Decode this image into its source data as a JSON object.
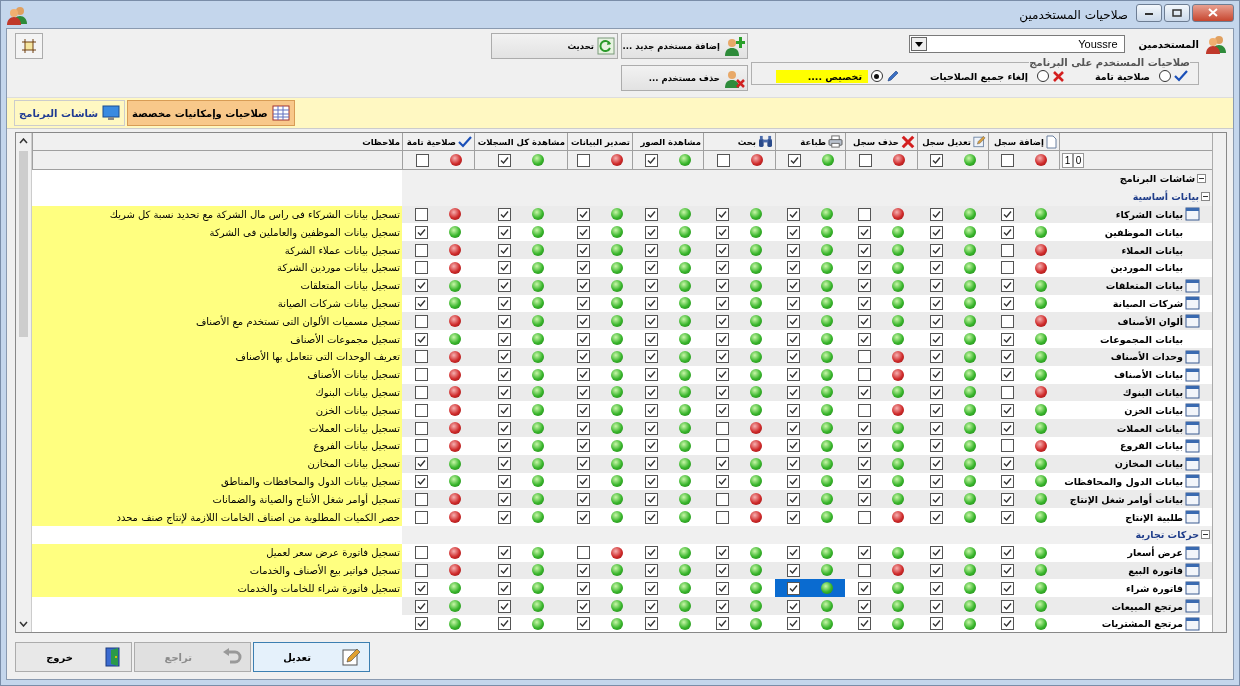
{
  "window": {
    "title": "صلاحيات المستخدمين"
  },
  "toolbar": {
    "users_label": "المستخدمين",
    "user": "Youssre",
    "add_user": "إضافة مستخدم جديد ...",
    "refresh": "تحديث",
    "delete_user": "حذف مستخدم ...",
    "permission_mode": {
      "legend": "صلاحيات المستخدم على البرنامج",
      "options": [
        {
          "label": "صلاحية تامة",
          "selected": false
        },
        {
          "label": "إلغاء جميع الصلاحيات",
          "selected": false
        },
        {
          "label": "تخصيص ....",
          "selected": true
        }
      ]
    }
  },
  "tabs": [
    {
      "label": "صلاحيات وإمكانيات مخصصة",
      "selected": true
    },
    {
      "label": "شاشات البرنامج",
      "selected": false
    }
  ],
  "grid": {
    "columns": [
      {
        "label": "إضافة سجل"
      },
      {
        "label": "تعديل سجل"
      },
      {
        "label": "حذف سجل"
      },
      {
        "label": "طباعة"
      },
      {
        "label": "بحث"
      },
      {
        "label": "مشاهدة الصور"
      },
      {
        "label": "تصدير البيانات"
      },
      {
        "label": "مشاهدة كل السجلات"
      },
      {
        "label": "صلاحية تامة"
      }
    ],
    "notes_label": "ملاحظات",
    "header_counters": [
      "0",
      "1"
    ],
    "header_checks": [
      {
        "checked": false
      },
      {
        "checked": true
      },
      {
        "checked": false
      },
      {
        "checked": true
      },
      {
        "checked": false
      },
      {
        "checked": true
      },
      {
        "checked": false
      },
      {
        "checked": true
      },
      {
        "checked": false
      }
    ],
    "tree": {
      "label": "شاشات البرنامج",
      "expanded": true,
      "children": [
        {
          "label": "بيانات أساسية",
          "expanded": true,
          "children": [
            {
              "label": "بيانات الشركاء",
              "has_icon": true,
              "note": "تسجيل بيانات الشركاء فى راس مال الشركة مع تحديد نسبة كل شريك",
              "perms": [
                {
                  "checked": true,
                  "selected": false
                },
                {
                  "checked": true,
                  "selected": false
                },
                {
                  "checked": false,
                  "selected": false
                },
                {
                  "checked": true,
                  "selected": false
                },
                {
                  "checked": true,
                  "selected": false
                },
                {
                  "checked": true,
                  "selected": false
                },
                {
                  "checked": true,
                  "selected": false
                },
                {
                  "checked": true,
                  "selected": false
                },
                {
                  "checked": false,
                  "selected": false
                }
              ]
            },
            {
              "label": "بيانات الموظفين",
              "has_icon": false,
              "note": "تسجيل بيانات الموظفين والعاملين فى الشركة",
              "perms": [
                {
                  "checked": true,
                  "selected": false
                },
                {
                  "checked": true,
                  "selected": false
                },
                {
                  "checked": true,
                  "selected": false
                },
                {
                  "checked": true,
                  "selected": false
                },
                {
                  "checked": true,
                  "selected": false
                },
                {
                  "checked": true,
                  "selected": false
                },
                {
                  "checked": true,
                  "selected": false
                },
                {
                  "checked": true,
                  "selected": false
                },
                {
                  "checked": true,
                  "selected": false
                }
              ]
            },
            {
              "label": "بيانات العملاء",
              "has_icon": false,
              "note": "تسجيل بيانات عملاء الشركة",
              "perms": [
                {
                  "checked": false,
                  "selected": false
                },
                {
                  "checked": true,
                  "selected": false
                },
                {
                  "checked": true,
                  "selected": false
                },
                {
                  "checked": true,
                  "selected": false
                },
                {
                  "checked": true,
                  "selected": false
                },
                {
                  "checked": true,
                  "selected": false
                },
                {
                  "checked": true,
                  "selected": false
                },
                {
                  "checked": true,
                  "selected": false
                },
                {
                  "checked": false,
                  "selected": false
                }
              ]
            },
            {
              "label": "بيانات الموردين",
              "has_icon": false,
              "note": "تسجيل بيانات موردين الشركة",
              "perms": [
                {
                  "checked": false,
                  "selected": false
                },
                {
                  "checked": true,
                  "selected": false
                },
                {
                  "checked": true,
                  "selected": false
                },
                {
                  "checked": true,
                  "selected": false
                },
                {
                  "checked": true,
                  "selected": false
                },
                {
                  "checked": true,
                  "selected": false
                },
                {
                  "checked": true,
                  "selected": false
                },
                {
                  "checked": true,
                  "selected": false
                },
                {
                  "checked": false,
                  "selected": false
                }
              ]
            },
            {
              "label": "بيانات  المتعلقات",
              "has_icon": true,
              "note": "تسجيل بيانات المتعلقات",
              "perms": [
                {
                  "checked": true,
                  "selected": false
                },
                {
                  "checked": true,
                  "selected": false
                },
                {
                  "checked": true,
                  "selected": false
                },
                {
                  "checked": true,
                  "selected": false
                },
                {
                  "checked": true,
                  "selected": false
                },
                {
                  "checked": true,
                  "selected": false
                },
                {
                  "checked": true,
                  "selected": false
                },
                {
                  "checked": true,
                  "selected": false
                },
                {
                  "checked": true,
                  "selected": false
                }
              ]
            },
            {
              "label": "شركات الصيانة",
              "has_icon": true,
              "note": "تسجيل بيانات شركات الصيانة",
              "perms": [
                {
                  "checked": true,
                  "selected": false
                },
                {
                  "checked": true,
                  "selected": false
                },
                {
                  "checked": true,
                  "selected": false
                },
                {
                  "checked": true,
                  "selected": false
                },
                {
                  "checked": true,
                  "selected": false
                },
                {
                  "checked": true,
                  "selected": false
                },
                {
                  "checked": true,
                  "selected": false
                },
                {
                  "checked": true,
                  "selected": false
                },
                {
                  "checked": true,
                  "selected": false
                }
              ]
            },
            {
              "label": "ألوان الأصناف",
              "has_icon": true,
              "note": "تسجيل مسميات الألوان التى تستخدم مع الأصناف",
              "perms": [
                {
                  "checked": false,
                  "selected": false
                },
                {
                  "checked": true,
                  "selected": false
                },
                {
                  "checked": true,
                  "selected": false
                },
                {
                  "checked": true,
                  "selected": false
                },
                {
                  "checked": true,
                  "selected": false
                },
                {
                  "checked": true,
                  "selected": false
                },
                {
                  "checked": true,
                  "selected": false
                },
                {
                  "checked": true,
                  "selected": false
                },
                {
                  "checked": false,
                  "selected": false
                }
              ]
            },
            {
              "label": "بيانات المجموعات",
              "has_icon": false,
              "note": "تسجيل  مجموعات الأصناف",
              "perms": [
                {
                  "checked": true,
                  "selected": false
                },
                {
                  "checked": true,
                  "selected": false
                },
                {
                  "checked": true,
                  "selected": false
                },
                {
                  "checked": true,
                  "selected": false
                },
                {
                  "checked": true,
                  "selected": false
                },
                {
                  "checked": true,
                  "selected": false
                },
                {
                  "checked": true,
                  "selected": false
                },
                {
                  "checked": true,
                  "selected": false
                },
                {
                  "checked": true,
                  "selected": false
                }
              ]
            },
            {
              "label": "وحدات الأصناف",
              "has_icon": true,
              "note": "تعريف الوحدات التى تتعامل بها الأصناف",
              "perms": [
                {
                  "checked": true,
                  "selected": false
                },
                {
                  "checked": true,
                  "selected": false
                },
                {
                  "checked": false,
                  "selected": false
                },
                {
                  "checked": true,
                  "selected": false
                },
                {
                  "checked": true,
                  "selected": false
                },
                {
                  "checked": true,
                  "selected": false
                },
                {
                  "checked": true,
                  "selected": false
                },
                {
                  "checked": true,
                  "selected": false
                },
                {
                  "checked": false,
                  "selected": false
                }
              ]
            },
            {
              "label": "بيانات الأصناف",
              "has_icon": true,
              "note": "تسجيل  بيانات الأصناف",
              "perms": [
                {
                  "checked": true,
                  "selected": false
                },
                {
                  "checked": true,
                  "selected": false
                },
                {
                  "checked": false,
                  "selected": false
                },
                {
                  "checked": true,
                  "selected": false
                },
                {
                  "checked": true,
                  "selected": false
                },
                {
                  "checked": true,
                  "selected": false
                },
                {
                  "checked": true,
                  "selected": false
                },
                {
                  "checked": true,
                  "selected": false
                },
                {
                  "checked": false,
                  "selected": false
                }
              ]
            },
            {
              "label": "بيانات البنوك",
              "has_icon": true,
              "note": "تسجيل  بيانات البنوك",
              "perms": [
                {
                  "checked": false,
                  "selected": false
                },
                {
                  "checked": true,
                  "selected": false
                },
                {
                  "checked": true,
                  "selected": false
                },
                {
                  "checked": true,
                  "selected": false
                },
                {
                  "checked": true,
                  "selected": false
                },
                {
                  "checked": true,
                  "selected": false
                },
                {
                  "checked": true,
                  "selected": false
                },
                {
                  "checked": true,
                  "selected": false
                },
                {
                  "checked": false,
                  "selected": false
                }
              ]
            },
            {
              "label": "بيانات الخزن",
              "has_icon": true,
              "note": "تسجيل  بيانات الخزن",
              "perms": [
                {
                  "checked": true,
                  "selected": false
                },
                {
                  "checked": true,
                  "selected": false
                },
                {
                  "checked": false,
                  "selected": false
                },
                {
                  "checked": true,
                  "selected": false
                },
                {
                  "checked": true,
                  "selected": false
                },
                {
                  "checked": true,
                  "selected": false
                },
                {
                  "checked": true,
                  "selected": false
                },
                {
                  "checked": true,
                  "selected": false
                },
                {
                  "checked": false,
                  "selected": false
                }
              ]
            },
            {
              "label": "بيانات العملات",
              "has_icon": true,
              "note": "تسجيل  بيانات العملات",
              "perms": [
                {
                  "checked": true,
                  "selected": false
                },
                {
                  "checked": true,
                  "selected": false
                },
                {
                  "checked": true,
                  "selected": false
                },
                {
                  "checked": true,
                  "selected": false
                },
                {
                  "checked": false,
                  "selected": false
                },
                {
                  "checked": true,
                  "selected": false
                },
                {
                  "checked": true,
                  "selected": false
                },
                {
                  "checked": true,
                  "selected": false
                },
                {
                  "checked": false,
                  "selected": false
                }
              ]
            },
            {
              "label": "بيانات الفروع",
              "has_icon": true,
              "note": "تسجيل  بيانات الفروع",
              "perms": [
                {
                  "checked": false,
                  "selected": false
                },
                {
                  "checked": true,
                  "selected": false
                },
                {
                  "checked": true,
                  "selected": false
                },
                {
                  "checked": true,
                  "selected": false
                },
                {
                  "checked": false,
                  "selected": false
                },
                {
                  "checked": true,
                  "selected": false
                },
                {
                  "checked": true,
                  "selected": false
                },
                {
                  "checked": true,
                  "selected": false
                },
                {
                  "checked": false,
                  "selected": false
                }
              ]
            },
            {
              "label": "بيانات المخازن",
              "has_icon": true,
              "note": "تسجيل  بيانات المخازن",
              "perms": [
                {
                  "checked": true,
                  "selected": false
                },
                {
                  "checked": true,
                  "selected": false
                },
                {
                  "checked": true,
                  "selected": false
                },
                {
                  "checked": true,
                  "selected": false
                },
                {
                  "checked": true,
                  "selected": false
                },
                {
                  "checked": true,
                  "selected": false
                },
                {
                  "checked": true,
                  "selected": false
                },
                {
                  "checked": true,
                  "selected": false
                },
                {
                  "checked": true,
                  "selected": false
                }
              ]
            },
            {
              "label": "بيانات الدول والمحافظات",
              "has_icon": true,
              "note": "تسجيل  بيانات الدول والمحافظات والمناطق",
              "perms": [
                {
                  "checked": true,
                  "selected": false
                },
                {
                  "checked": true,
                  "selected": false
                },
                {
                  "checked": true,
                  "selected": false
                },
                {
                  "checked": true,
                  "selected": false
                },
                {
                  "checked": true,
                  "selected": false
                },
                {
                  "checked": true,
                  "selected": false
                },
                {
                  "checked": true,
                  "selected": false
                },
                {
                  "checked": true,
                  "selected": false
                },
                {
                  "checked": true,
                  "selected": false
                }
              ]
            },
            {
              "label": "بيانات أوامر شغل الإنتاج",
              "has_icon": true,
              "note": "تسجيل أوامر شغل الأنتاج والصيانة والضمانات",
              "perms": [
                {
                  "checked": true,
                  "selected": false
                },
                {
                  "checked": true,
                  "selected": false
                },
                {
                  "checked": true,
                  "selected": false
                },
                {
                  "checked": true,
                  "selected": false
                },
                {
                  "checked": false,
                  "selected": false
                },
                {
                  "checked": true,
                  "selected": false
                },
                {
                  "checked": true,
                  "selected": false
                },
                {
                  "checked": true,
                  "selected": false
                },
                {
                  "checked": false,
                  "selected": false
                }
              ]
            },
            {
              "label": "طلبية الإنتاج",
              "has_icon": true,
              "note": "حصر الكميات المطلوبة من اصناف الخامات اللازمة لإنتاج صنف محدد",
              "perms": [
                {
                  "checked": true,
                  "selected": false
                },
                {
                  "checked": true,
                  "selected": false
                },
                {
                  "checked": false,
                  "selected": false
                },
                {
                  "checked": true,
                  "selected": false
                },
                {
                  "checked": false,
                  "selected": false
                },
                {
                  "checked": true,
                  "selected": false
                },
                {
                  "checked": true,
                  "selected": false
                },
                {
                  "checked": true,
                  "selected": false
                },
                {
                  "checked": false,
                  "selected": false
                }
              ]
            }
          ]
        },
        {
          "label": "حركات تجارية",
          "expanded": true,
          "children": [
            {
              "label": "عرض أسعار",
              "has_icon": true,
              "note": "تسجيل فاتورة عرض سعر لعميل",
              "perms": [
                {
                  "checked": true,
                  "selected": false
                },
                {
                  "checked": true,
                  "selected": false
                },
                {
                  "checked": true,
                  "selected": false
                },
                {
                  "checked": true,
                  "selected": false
                },
                {
                  "checked": true,
                  "selected": false
                },
                {
                  "checked": true,
                  "selected": false
                },
                {
                  "checked": false,
                  "selected": false
                },
                {
                  "checked": true,
                  "selected": false
                },
                {
                  "checked": false,
                  "selected": false
                }
              ]
            },
            {
              "label": "فاتورة البيع",
              "has_icon": true,
              "note": "تسجيل فواتير بيع الأصناف والخدمات",
              "perms": [
                {
                  "checked": true,
                  "selected": false
                },
                {
                  "checked": true,
                  "selected": false
                },
                {
                  "checked": false,
                  "selected": false
                },
                {
                  "checked": true,
                  "selected": false
                },
                {
                  "checked": true,
                  "selected": false
                },
                {
                  "checked": true,
                  "selected": false
                },
                {
                  "checked": true,
                  "selected": false
                },
                {
                  "checked": true,
                  "selected": false
                },
                {
                  "checked": false,
                  "selected": false
                }
              ]
            },
            {
              "label": "فاتورة شراء",
              "has_icon": true,
              "note": "تسجيل فاتورة شراء للخامات والخدمات",
              "perms": [
                {
                  "checked": true,
                  "selected": false
                },
                {
                  "checked": true,
                  "selected": false
                },
                {
                  "checked": true,
                  "selected": false
                },
                {
                  "checked": true,
                  "selected": true
                },
                {
                  "checked": true,
                  "selected": false
                },
                {
                  "checked": true,
                  "selected": false
                },
                {
                  "checked": true,
                  "selected": false
                },
                {
                  "checked": true,
                  "selected": false
                },
                {
                  "checked": true,
                  "selected": false
                }
              ]
            },
            {
              "label": "مرتجع المبيعات",
              "has_icon": true,
              "perms": [
                {
                  "checked": true,
                  "selected": false
                },
                {
                  "checked": true,
                  "selected": false
                },
                {
                  "checked": true,
                  "selected": false
                },
                {
                  "checked": true,
                  "selected": false
                },
                {
                  "checked": true,
                  "selected": false
                },
                {
                  "checked": true,
                  "selected": false
                },
                {
                  "checked": true,
                  "selected": false
                },
                {
                  "checked": true,
                  "selected": false
                },
                {
                  "checked": true,
                  "selected": false
                }
              ]
            },
            {
              "label": "مرتجع المشتريات",
              "has_icon": true,
              "perms": [
                {
                  "checked": true,
                  "selected": false
                },
                {
                  "checked": true,
                  "selected": false
                },
                {
                  "checked": true,
                  "selected": false
                },
                {
                  "checked": true,
                  "selected": false
                },
                {
                  "checked": true,
                  "selected": false
                },
                {
                  "checked": true,
                  "selected": false
                },
                {
                  "checked": true,
                  "selected": false
                },
                {
                  "checked": true,
                  "selected": false
                },
                {
                  "checked": true,
                  "selected": false
                }
              ]
            }
          ]
        }
      ]
    }
  },
  "footer": {
    "buttons": [
      {
        "label": "تعديل",
        "disabled": false,
        "focused": true
      },
      {
        "label": "تراجع",
        "disabled": true,
        "focused": false
      },
      {
        "label": "خروج",
        "disabled": false,
        "focused": false
      }
    ]
  }
}
